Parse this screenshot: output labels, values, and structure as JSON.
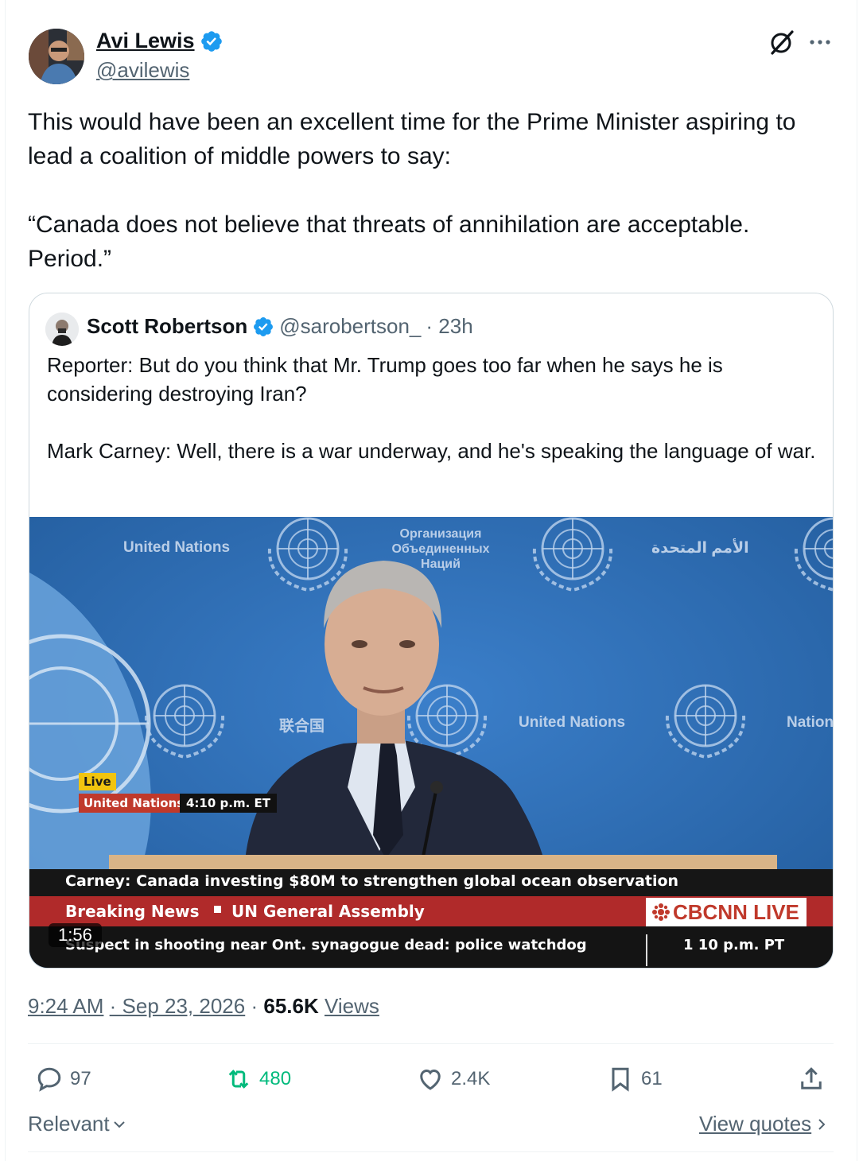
{
  "author": {
    "name": "Avi Lewis",
    "handle": "@avilewis"
  },
  "tweet": {
    "paragraph1": "This would have been an excellent time for the Prime Minister aspiring to lead a coalition of middle powers to say:",
    "paragraph2": "“Canada does not believe that threats of annihilation are acceptable. Period.”"
  },
  "quoted": {
    "name": "Scott Robertson",
    "handle": "@sarobertson_",
    "time": "· 23h",
    "paragraph1": "Reporter: But do you think that Mr. Trump goes too far when he says he is considering destroying Iran?",
    "paragraph2": "Mark Carney: Well, there is a war underway, and he's speaking the language of war."
  },
  "video": {
    "bg_label_left": "United Nations",
    "bg_label_ru": "Организация Объединенных Наций",
    "bg_label_ar": "الأمم المتحدة",
    "bg_label_zh": "联合国",
    "bg_label_center": "United Nations",
    "bg_label_right": "Nation",
    "live_tag": "Live",
    "location_tag": "United Nations",
    "time_tag": "4:10 p.m. ET",
    "headline": "Carney: Canada investing $80M to strengthen global ocean observation",
    "breaking": "Breaking News",
    "assembly": "UN General Assembly",
    "network": "CBCNN LIVE",
    "ticker": "Suspect in shooting near Ont. synagogue dead: police watchdog",
    "ticker_time": "1 10 p.m. PT",
    "duration": "1:56"
  },
  "meta": {
    "time": "9:24 AM",
    "date": "Sep 23, 2026",
    "views_count": "65.6K",
    "views_label": "Views"
  },
  "actions": {
    "replies": "97",
    "reposts": "480",
    "likes": "2.4K",
    "bookmarks": "61"
  },
  "footer": {
    "sort_label": "Relevant",
    "view_quotes": "View quotes"
  },
  "colors": {
    "text": "#0f1419",
    "secondary": "#536471",
    "verified": "#1d9bf0",
    "repost": "#00ba7c",
    "un_blue": "#2f6fb8"
  }
}
